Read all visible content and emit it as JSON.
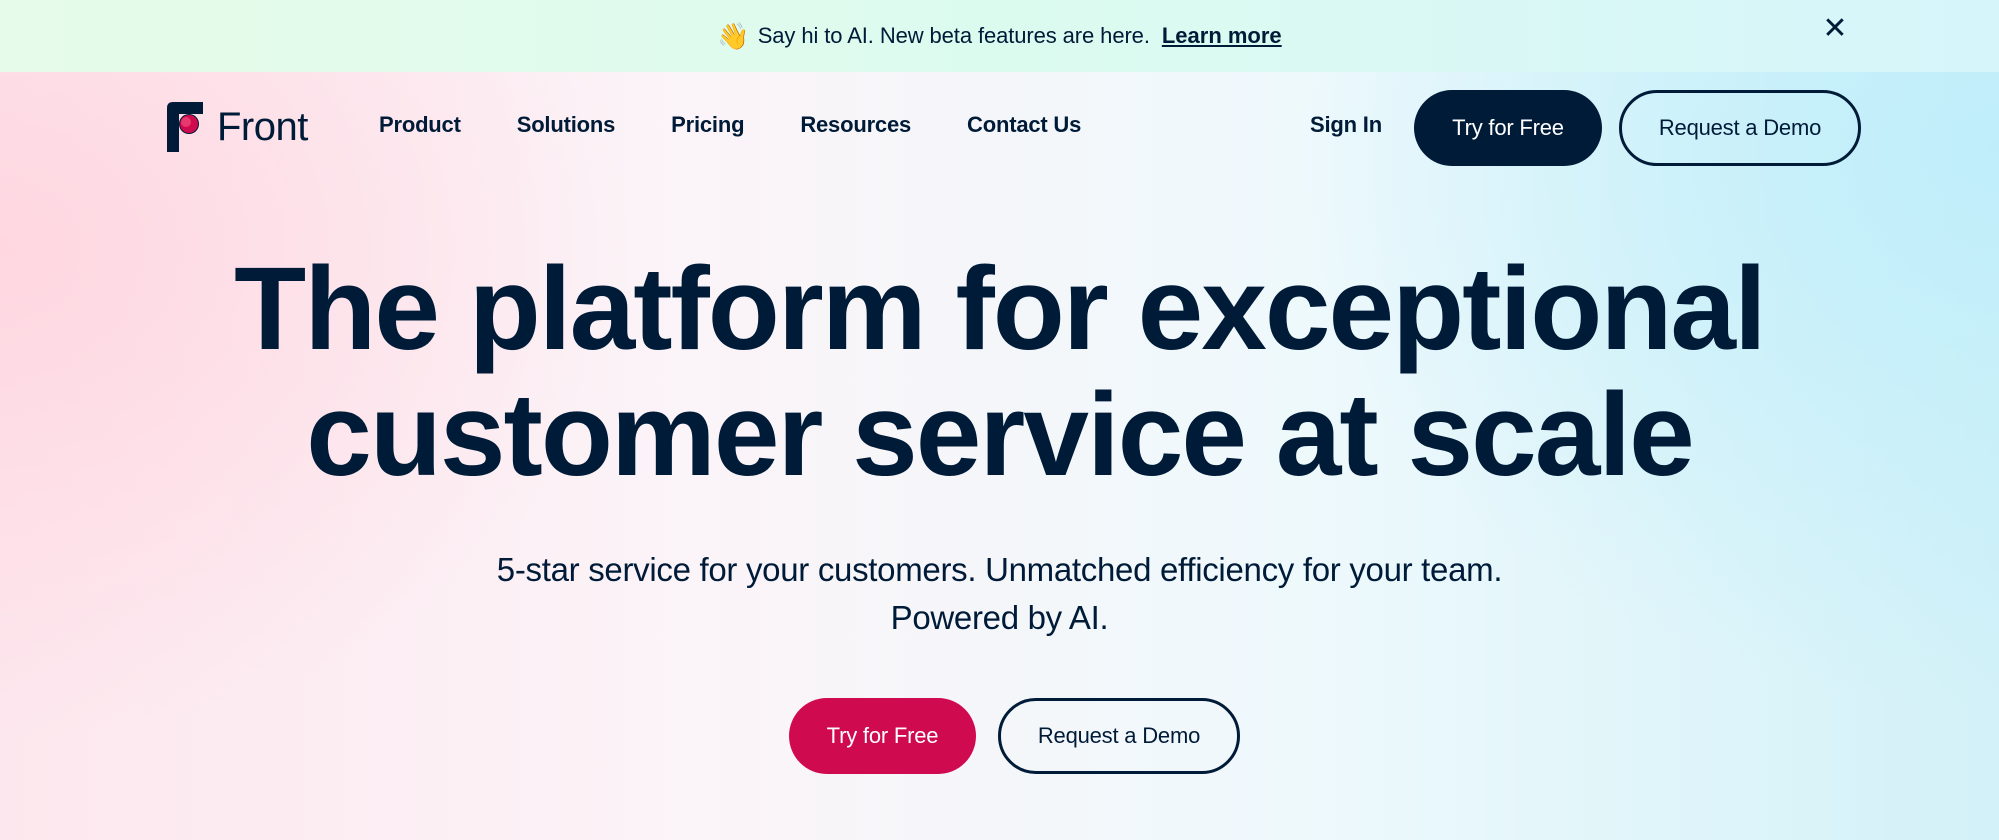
{
  "banner": {
    "wave_icon": "👋",
    "message": "Say hi to AI. New beta features are here.",
    "link_label": "Learn more",
    "close_icon": "✕"
  },
  "header": {
    "logo_text": "Front",
    "nav": [
      {
        "label": "Product"
      },
      {
        "label": "Solutions"
      },
      {
        "label": "Pricing"
      },
      {
        "label": "Resources"
      },
      {
        "label": "Contact Us"
      }
    ],
    "sign_in": "Sign In",
    "try_free": "Try for Free",
    "request_demo": "Request a Demo"
  },
  "hero": {
    "title_line1": "The platform for exceptional",
    "title_line2": "customer service at scale",
    "subtitle_line1": "5-star service for your customers. Unmatched efficiency for your team.",
    "subtitle_line2": "Powered by AI.",
    "try_free": "Try for Free",
    "request_demo": "Request a Demo"
  },
  "colors": {
    "navy": "#001B38",
    "brand_red": "#CF0A4E",
    "banner_bg": "#DCFBEF"
  }
}
